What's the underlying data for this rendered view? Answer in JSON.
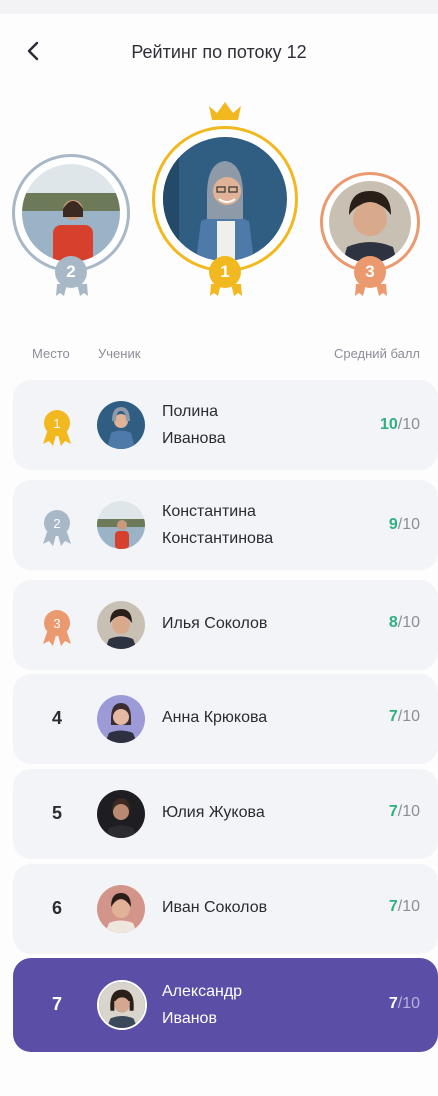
{
  "header": {
    "title": "Рейтинг по потоку 12",
    "back_icon": "chevron-left-icon"
  },
  "podium": [
    {
      "place": "2",
      "color": "#a9b8c6"
    },
    {
      "place": "1",
      "color": "#f2b81f"
    },
    {
      "place": "3",
      "color": "#ea9a6e"
    }
  ],
  "columns": {
    "place": "Место",
    "student": "Ученик",
    "score": "Средний балл"
  },
  "rows": [
    {
      "place": "1",
      "name_line1": "Полина",
      "name_line2": "Иванова",
      "score": "10",
      "max": "/10",
      "medal": "gold-medal-icon"
    },
    {
      "place": "2",
      "name_line1": "Константина",
      "name_line2": "Константинова",
      "score": "9",
      "max": "/10",
      "medal": "silver-medal-icon"
    },
    {
      "place": "3",
      "name": "Илья Соколов",
      "score": "8",
      "max": "/10",
      "medal": "bronze-medal-icon"
    },
    {
      "place": "4",
      "name": "Анна Крюкова",
      "score": "7",
      "max": "/10"
    },
    {
      "place": "5",
      "name": "Юлия Жукова",
      "score": "7",
      "max": "/10"
    },
    {
      "place": "6",
      "name": "Иван Соколов",
      "score": "7",
      "max": "/10"
    },
    {
      "place": "7",
      "name_line1": "Александр",
      "name_line2": "Иванов",
      "score": "7",
      "max": "/10",
      "highlighted": true
    }
  ],
  "colors": {
    "accent": "#5b4ea6",
    "score_green": "#2fb07f",
    "gold": "#f2b81f",
    "silver": "#a9b8c6",
    "bronze": "#ea9a6e"
  }
}
